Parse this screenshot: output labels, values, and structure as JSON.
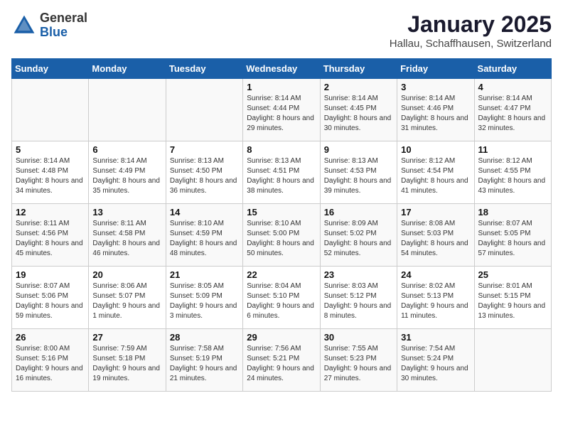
{
  "logo": {
    "general": "General",
    "blue": "Blue"
  },
  "calendar": {
    "title": "January 2025",
    "subtitle": "Hallau, Schaffhausen, Switzerland"
  },
  "headers": [
    "Sunday",
    "Monday",
    "Tuesday",
    "Wednesday",
    "Thursday",
    "Friday",
    "Saturday"
  ],
  "weeks": [
    [
      {
        "day": "",
        "info": ""
      },
      {
        "day": "",
        "info": ""
      },
      {
        "day": "",
        "info": ""
      },
      {
        "day": "1",
        "info": "Sunrise: 8:14 AM\nSunset: 4:44 PM\nDaylight: 8 hours and 29 minutes."
      },
      {
        "day": "2",
        "info": "Sunrise: 8:14 AM\nSunset: 4:45 PM\nDaylight: 8 hours and 30 minutes."
      },
      {
        "day": "3",
        "info": "Sunrise: 8:14 AM\nSunset: 4:46 PM\nDaylight: 8 hours and 31 minutes."
      },
      {
        "day": "4",
        "info": "Sunrise: 8:14 AM\nSunset: 4:47 PM\nDaylight: 8 hours and 32 minutes."
      }
    ],
    [
      {
        "day": "5",
        "info": "Sunrise: 8:14 AM\nSunset: 4:48 PM\nDaylight: 8 hours and 34 minutes."
      },
      {
        "day": "6",
        "info": "Sunrise: 8:14 AM\nSunset: 4:49 PM\nDaylight: 8 hours and 35 minutes."
      },
      {
        "day": "7",
        "info": "Sunrise: 8:13 AM\nSunset: 4:50 PM\nDaylight: 8 hours and 36 minutes."
      },
      {
        "day": "8",
        "info": "Sunrise: 8:13 AM\nSunset: 4:51 PM\nDaylight: 8 hours and 38 minutes."
      },
      {
        "day": "9",
        "info": "Sunrise: 8:13 AM\nSunset: 4:53 PM\nDaylight: 8 hours and 39 minutes."
      },
      {
        "day": "10",
        "info": "Sunrise: 8:12 AM\nSunset: 4:54 PM\nDaylight: 8 hours and 41 minutes."
      },
      {
        "day": "11",
        "info": "Sunrise: 8:12 AM\nSunset: 4:55 PM\nDaylight: 8 hours and 43 minutes."
      }
    ],
    [
      {
        "day": "12",
        "info": "Sunrise: 8:11 AM\nSunset: 4:56 PM\nDaylight: 8 hours and 45 minutes."
      },
      {
        "day": "13",
        "info": "Sunrise: 8:11 AM\nSunset: 4:58 PM\nDaylight: 8 hours and 46 minutes."
      },
      {
        "day": "14",
        "info": "Sunrise: 8:10 AM\nSunset: 4:59 PM\nDaylight: 8 hours and 48 minutes."
      },
      {
        "day": "15",
        "info": "Sunrise: 8:10 AM\nSunset: 5:00 PM\nDaylight: 8 hours and 50 minutes."
      },
      {
        "day": "16",
        "info": "Sunrise: 8:09 AM\nSunset: 5:02 PM\nDaylight: 8 hours and 52 minutes."
      },
      {
        "day": "17",
        "info": "Sunrise: 8:08 AM\nSunset: 5:03 PM\nDaylight: 8 hours and 54 minutes."
      },
      {
        "day": "18",
        "info": "Sunrise: 8:07 AM\nSunset: 5:05 PM\nDaylight: 8 hours and 57 minutes."
      }
    ],
    [
      {
        "day": "19",
        "info": "Sunrise: 8:07 AM\nSunset: 5:06 PM\nDaylight: 8 hours and 59 minutes."
      },
      {
        "day": "20",
        "info": "Sunrise: 8:06 AM\nSunset: 5:07 PM\nDaylight: 9 hours and 1 minute."
      },
      {
        "day": "21",
        "info": "Sunrise: 8:05 AM\nSunset: 5:09 PM\nDaylight: 9 hours and 3 minutes."
      },
      {
        "day": "22",
        "info": "Sunrise: 8:04 AM\nSunset: 5:10 PM\nDaylight: 9 hours and 6 minutes."
      },
      {
        "day": "23",
        "info": "Sunrise: 8:03 AM\nSunset: 5:12 PM\nDaylight: 9 hours and 8 minutes."
      },
      {
        "day": "24",
        "info": "Sunrise: 8:02 AM\nSunset: 5:13 PM\nDaylight: 9 hours and 11 minutes."
      },
      {
        "day": "25",
        "info": "Sunrise: 8:01 AM\nSunset: 5:15 PM\nDaylight: 9 hours and 13 minutes."
      }
    ],
    [
      {
        "day": "26",
        "info": "Sunrise: 8:00 AM\nSunset: 5:16 PM\nDaylight: 9 hours and 16 minutes."
      },
      {
        "day": "27",
        "info": "Sunrise: 7:59 AM\nSunset: 5:18 PM\nDaylight: 9 hours and 19 minutes."
      },
      {
        "day": "28",
        "info": "Sunrise: 7:58 AM\nSunset: 5:19 PM\nDaylight: 9 hours and 21 minutes."
      },
      {
        "day": "29",
        "info": "Sunrise: 7:56 AM\nSunset: 5:21 PM\nDaylight: 9 hours and 24 minutes."
      },
      {
        "day": "30",
        "info": "Sunrise: 7:55 AM\nSunset: 5:23 PM\nDaylight: 9 hours and 27 minutes."
      },
      {
        "day": "31",
        "info": "Sunrise: 7:54 AM\nSunset: 5:24 PM\nDaylight: 9 hours and 30 minutes."
      },
      {
        "day": "",
        "info": ""
      }
    ]
  ]
}
